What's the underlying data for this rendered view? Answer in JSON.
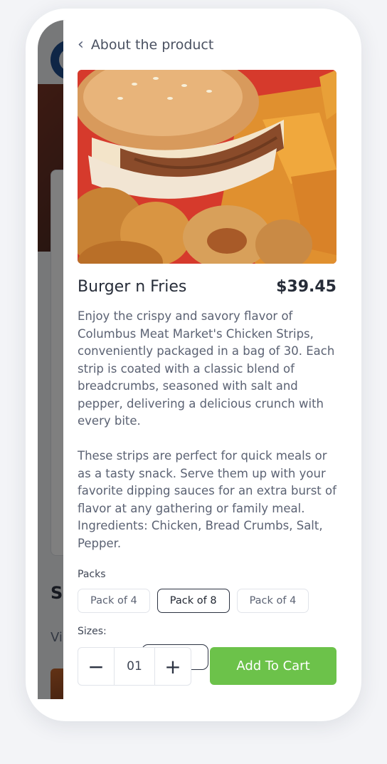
{
  "background_page": {
    "section_heading_partial": "S",
    "subtext_partial": "Vi"
  },
  "header": {
    "back_label": "About the product"
  },
  "product": {
    "image_alt": "Burger with fries and onion rings",
    "name": "Burger n Fries",
    "price": "$39.45",
    "description": [
      "Enjoy the crispy and savory flavor of Columbus Meat Market's Chicken Strips, conveniently packaged in a bag of 30. Each strip is coated with a classic blend of breadcrumbs, seasoned with salt and pepper, delivering a delicious crunch with every bite.",
      "These strips are perfect for quick meals or as a tasty snack. Serve them up with your favorite dipping sauces for an extra burst of flavor at any gathering or family meal. Ingredients: Chicken, Bread Crumbs, Salt, Pepper."
    ]
  },
  "packs": {
    "label": "Packs",
    "options": [
      {
        "label": "Pack of 4",
        "selected": false
      },
      {
        "label": "Pack of 8",
        "selected": true
      },
      {
        "label": "Pack of 4",
        "selected": false
      }
    ]
  },
  "sizes": {
    "label": "Sizes:"
  },
  "quantity": {
    "value": "01",
    "decrement_icon": "minus-icon",
    "increment_icon": "plus-icon"
  },
  "cart": {
    "add_label": "Add To Cart",
    "button_color": "#6cc24a"
  }
}
